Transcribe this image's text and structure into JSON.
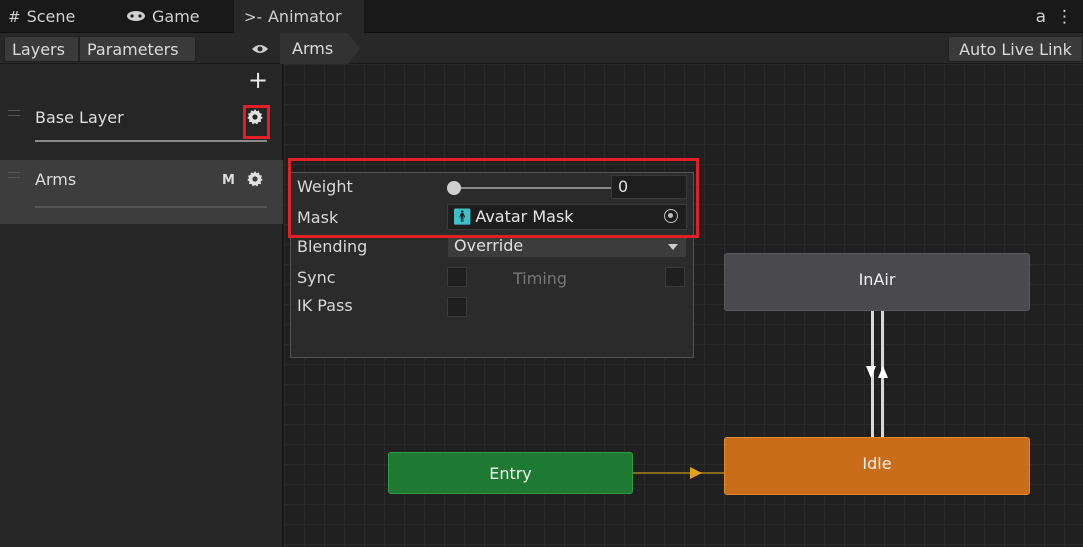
{
  "tabs": [
    {
      "label": "Scene",
      "icon": "grid-icon"
    },
    {
      "label": "Game",
      "icon": "gamepad-icon"
    },
    {
      "label": "Animator",
      "icon": "animator-icon"
    }
  ],
  "tabbar_right": {
    "lock_glyph": "a",
    "menu_glyph": "⋮"
  },
  "toolbar": {
    "layers_label": "Layers",
    "parameters_label": "Parameters",
    "breadcrumb": "Arms",
    "auto_live_link": "Auto Live Link"
  },
  "layers": {
    "add_glyph": "+",
    "items": [
      {
        "name": "Base Layer",
        "badge": ""
      },
      {
        "name": "Arms",
        "badge": "M"
      }
    ]
  },
  "layer_settings": {
    "weight_label": "Weight",
    "weight_value": "0",
    "mask_label": "Mask",
    "mask_value": "Avatar Mask",
    "blending_label": "Blending",
    "blending_value": "Override",
    "sync_label": "Sync",
    "timing_label": "Timing",
    "ik_pass_label": "IK Pass",
    "sync_checked": false,
    "ik_pass_checked": false,
    "timing_checked": false
  },
  "states": {
    "inair": "InAir",
    "idle": "Idle",
    "entry": "Entry"
  },
  "colors": {
    "highlight": "#e21f26",
    "idle_node": "#c96d1a",
    "entry_node": "#1e7a32",
    "inair_node": "#4a4a4e",
    "mask_icon": "#3fc0c9"
  }
}
